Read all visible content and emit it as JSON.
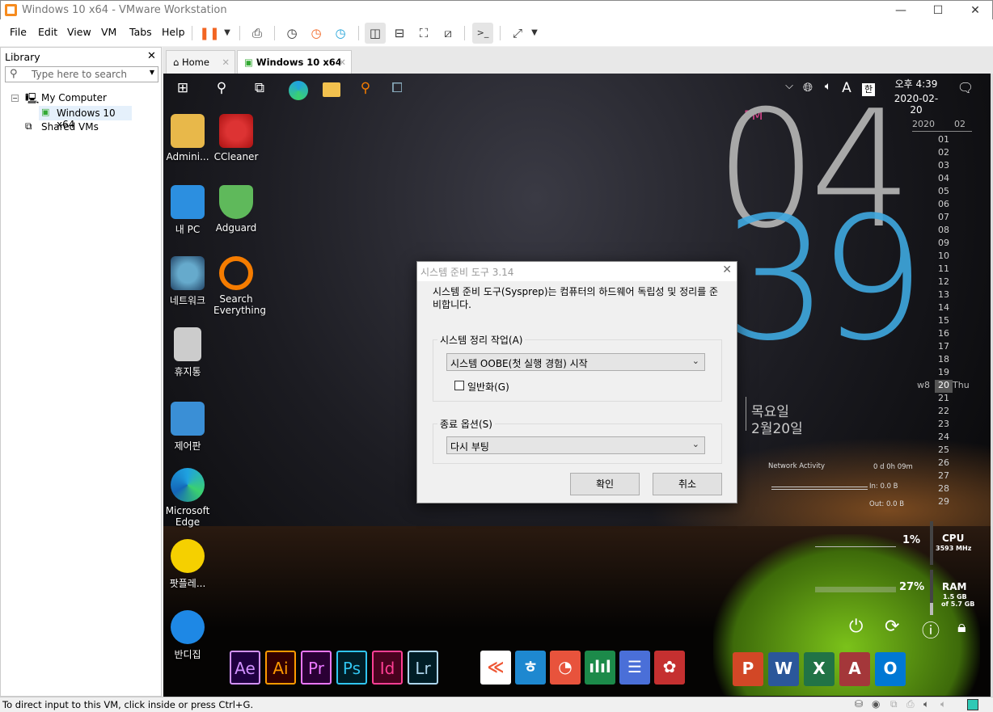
{
  "window": {
    "title": "Windows 10 x64 - VMware Workstation",
    "minimize": "—",
    "maximize": "☐",
    "close": "✕"
  },
  "menu": [
    "File",
    "Edit",
    "View",
    "VM",
    "Tabs",
    "Help"
  ],
  "library": {
    "title": "Library",
    "close": "✕",
    "search_placeholder": "Type here to search",
    "tree": {
      "root": "My Computer",
      "vm": "Windows 10 x64",
      "shared": "Shared VMs"
    }
  },
  "tabs": [
    {
      "label": "Home",
      "close": "✕"
    },
    {
      "label": "Windows 10 x64",
      "close": "✕"
    }
  ],
  "guest": {
    "tray": {
      "chevron": "⌵",
      "ime_a": "A",
      "ime_han": "한",
      "time": "오후 4:39",
      "date": "2020-02-20"
    },
    "desktop_icons": [
      "Admini...",
      "CCleaner",
      "내 PC",
      "Adguard",
      "네트워크",
      "Search Everything",
      "휴지통",
      "제어판",
      "Microsoft Edge",
      "팟플레...",
      "반디집"
    ],
    "clock": {
      "ampm": "PM",
      "hour": "04",
      "minute": "39",
      "weekday": "목요일",
      "date": "2월20일"
    },
    "calendar": {
      "year": "2020",
      "month": "02",
      "days": [
        "01",
        "02",
        "03",
        "04",
        "05",
        "06",
        "07",
        "08",
        "09",
        "10",
        "11",
        "12",
        "13",
        "14",
        "15",
        "16",
        "17",
        "18",
        "19",
        "20",
        "21",
        "22",
        "23",
        "24",
        "25",
        "26",
        "27",
        "28",
        "29"
      ],
      "today": "20",
      "week": "w8",
      "today_name": "Thu"
    },
    "network": {
      "title": "Network Activity",
      "uptime": "0 d 0h 09m",
      "in": "In: 0.0 B",
      "out": "Out: 0.0 B"
    },
    "cpu": {
      "percent": "1%",
      "label": "CPU",
      "freq": "3593 MHz",
      "value": 1
    },
    "ram": {
      "percent": "27%",
      "label": "RAM",
      "used": "1.5 GB",
      "total": "of 5.7 GB",
      "value": 27
    },
    "dock": {
      "adobe": [
        {
          "l": "Ae",
          "c": "#d291ff",
          "b": "#1f0040"
        },
        {
          "l": "Ai",
          "c": "#ff9a00",
          "b": "#330000"
        },
        {
          "l": "Pr",
          "c": "#ea77ff",
          "b": "#2a0034"
        },
        {
          "l": "Ps",
          "c": "#31c5f0",
          "b": "#001d26"
        },
        {
          "l": "Id",
          "c": "#ff3f94",
          "b": "#49021f"
        },
        {
          "l": "Lr",
          "c": "#add5ec",
          "b": "#001d26"
        }
      ],
      "office": [
        {
          "l": "P",
          "b": "#d24726"
        },
        {
          "l": "W",
          "b": "#2b579a"
        },
        {
          "l": "X",
          "b": "#217346"
        },
        {
          "l": "A",
          "b": "#a4373a"
        },
        {
          "l": "O",
          "b": "#0078d4"
        }
      ]
    }
  },
  "dialog": {
    "title": "시스템 준비 도구 3.14",
    "close": "✕",
    "description": "시스템 준비 도구(Sysprep)는 컴퓨터의 하드웨어 독립성 및 정리를 준비합니다.",
    "cleanup_label": "시스템 정리 작업(A)",
    "cleanup_value": "시스템 OOBE(첫 실행 경험) 시작",
    "generalize_label": "일반화(G)",
    "generalize_checked": false,
    "shutdown_label": "종료 옵션(S)",
    "shutdown_value": "다시 부팅",
    "ok": "확인",
    "cancel": "취소"
  },
  "status": {
    "text": "To direct input to this VM, click inside or press Ctrl+G."
  }
}
